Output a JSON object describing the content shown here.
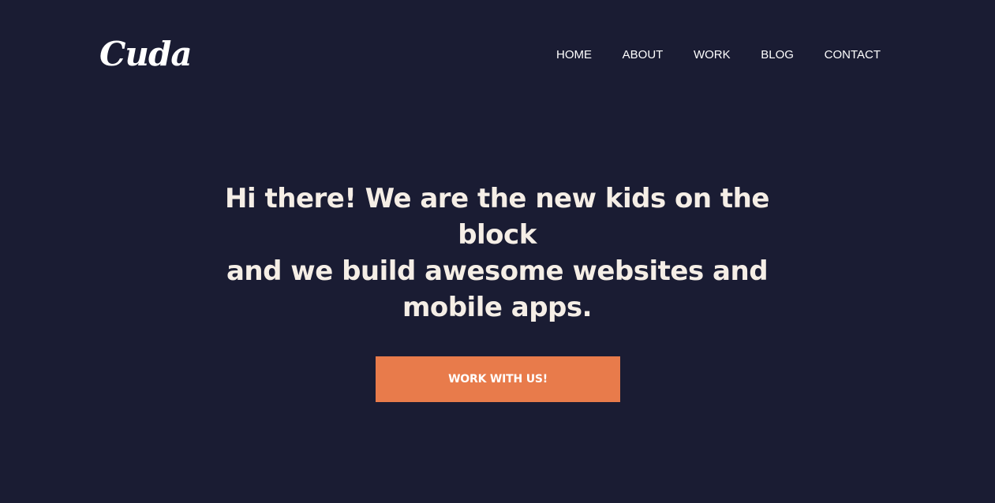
{
  "brand": {
    "logo_text": "Cuda"
  },
  "nav": {
    "items": [
      {
        "label": "HOME"
      },
      {
        "label": "ABOUT"
      },
      {
        "label": "WORK"
      },
      {
        "label": "BLOG"
      },
      {
        "label": "CONTACT"
      }
    ]
  },
  "hero": {
    "headline_lines": [
      "Hi there! We are the new kids on the block",
      "and we build awesome websites and",
      "mobile apps."
    ],
    "cta_label": "WORK WITH US!"
  },
  "colors": {
    "background": "#1a1c33",
    "text": "#f5eee6",
    "accent": "#e87b4b"
  }
}
